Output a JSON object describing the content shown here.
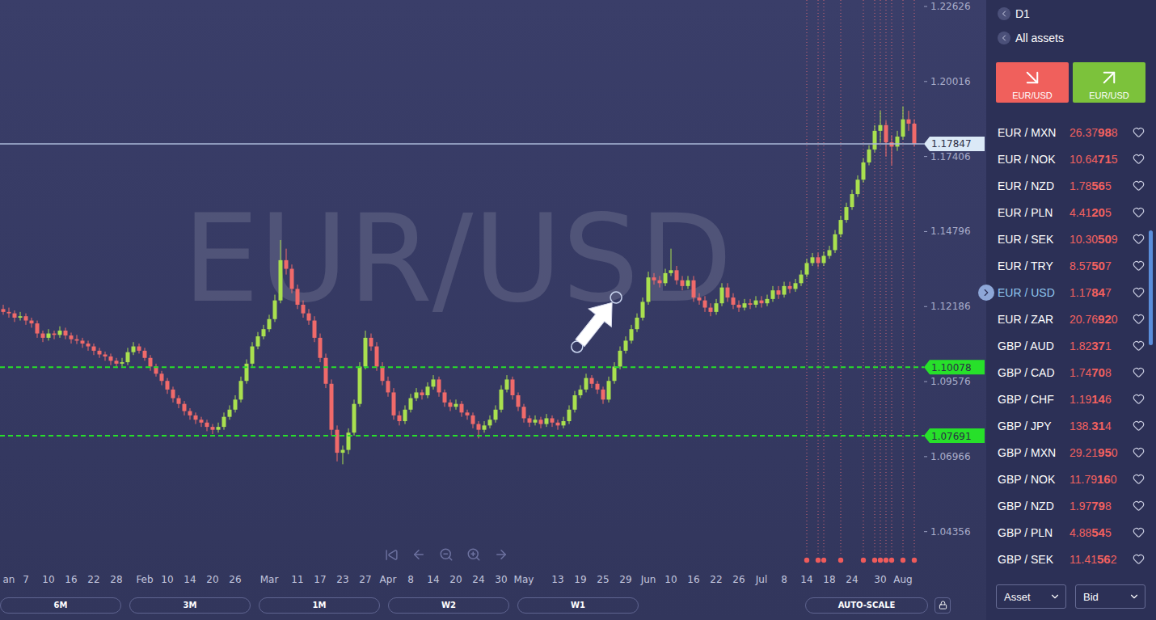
{
  "chart": {
    "watermark": "EUR/USD",
    "price_ticks": [
      "1.22626",
      "1.20016",
      "1.17406",
      "1.14796",
      "1.12186",
      "1.09576",
      "1.06966",
      "1.04356"
    ],
    "current_price": "1.17847",
    "levels": [
      "1.10078",
      "1.07691"
    ],
    "date_labels": [
      {
        "label": "an",
        "candle": 1
      },
      {
        "label": "7",
        "candle": 4
      },
      {
        "label": "10",
        "candle": 8
      },
      {
        "label": "16",
        "candle": 12
      },
      {
        "label": "22",
        "candle": 16
      },
      {
        "label": "28",
        "candle": 20
      },
      {
        "label": "Feb",
        "candle": 25
      },
      {
        "label": "10",
        "candle": 29
      },
      {
        "label": "14",
        "candle": 33
      },
      {
        "label": "20",
        "candle": 37
      },
      {
        "label": "26",
        "candle": 41
      },
      {
        "label": "Mar",
        "candle": 47
      },
      {
        "label": "11",
        "candle": 52
      },
      {
        "label": "17",
        "candle": 56
      },
      {
        "label": "23",
        "candle": 60
      },
      {
        "label": "27",
        "candle": 64
      },
      {
        "label": "Apr",
        "candle": 68
      },
      {
        "label": "8",
        "candle": 72
      },
      {
        "label": "14",
        "candle": 76
      },
      {
        "label": "20",
        "candle": 80
      },
      {
        "label": "24",
        "candle": 84
      },
      {
        "label": "30",
        "candle": 88
      },
      {
        "label": "May",
        "candle": 92
      },
      {
        "label": "13",
        "candle": 98
      },
      {
        "label": "19",
        "candle": 102
      },
      {
        "label": "25",
        "candle": 106
      },
      {
        "label": "29",
        "candle": 110
      },
      {
        "label": "Jun",
        "candle": 114
      },
      {
        "label": "10",
        "candle": 118
      },
      {
        "label": "16",
        "candle": 122
      },
      {
        "label": "22",
        "candle": 126
      },
      {
        "label": "26",
        "candle": 130
      },
      {
        "label": "Jul",
        "candle": 134
      },
      {
        "label": "8",
        "candle": 138
      },
      {
        "label": "14",
        "candle": 142
      },
      {
        "label": "18",
        "candle": 146
      },
      {
        "label": "24",
        "candle": 150
      },
      {
        "label": "30",
        "candle": 155
      },
      {
        "label": "Aug",
        "candle": 159
      }
    ],
    "trade_markers": [
      142,
      144,
      145,
      148,
      152,
      154,
      155,
      156,
      157,
      159,
      161
    ],
    "annotation": {
      "from": {
        "candle": 101.4,
        "price": 1.1079
      },
      "to": {
        "candle": 108.3,
        "price": 1.125
      }
    },
    "candles": [
      [
        1.121,
        1.1225,
        1.119,
        1.12
      ],
      [
        1.12,
        1.1215,
        1.118,
        1.1195
      ],
      [
        1.1195,
        1.1205,
        1.1165,
        1.118
      ],
      [
        1.118,
        1.12,
        1.117,
        1.1185
      ],
      [
        1.1185,
        1.1195,
        1.1155,
        1.117
      ],
      [
        1.117,
        1.118,
        1.1145,
        1.116
      ],
      [
        1.116,
        1.117,
        1.111,
        1.1125
      ],
      [
        1.1125,
        1.1135,
        1.1095,
        1.111
      ],
      [
        1.111,
        1.114,
        1.11,
        1.1125
      ],
      [
        1.1125,
        1.1135,
        1.1105,
        1.112
      ],
      [
        1.112,
        1.115,
        1.111,
        1.1135
      ],
      [
        1.1135,
        1.1145,
        1.1105,
        1.1118
      ],
      [
        1.1118,
        1.1128,
        1.109,
        1.1105
      ],
      [
        1.1105,
        1.112,
        1.1088,
        1.11
      ],
      [
        1.11,
        1.111,
        1.1075,
        1.109
      ],
      [
        1.109,
        1.11,
        1.1065,
        1.108
      ],
      [
        1.108,
        1.109,
        1.105,
        1.1065
      ],
      [
        1.1065,
        1.1075,
        1.104,
        1.1052
      ],
      [
        1.1052,
        1.1062,
        1.103,
        1.1045
      ],
      [
        1.1045,
        1.1055,
        1.1015,
        1.103
      ],
      [
        1.103,
        1.104,
        1.1005,
        1.102
      ],
      [
        1.102,
        1.104,
        1.101,
        1.1025
      ],
      [
        1.1025,
        1.1075,
        1.1015,
        1.106
      ],
      [
        1.106,
        1.1095,
        1.105,
        1.108
      ],
      [
        1.108,
        1.109,
        1.1055,
        1.1065
      ],
      [
        1.1065,
        1.1075,
        1.103,
        1.104
      ],
      [
        1.104,
        1.105,
        1.0995,
        1.101
      ],
      [
        1.101,
        1.102,
        1.0975,
        1.0985
      ],
      [
        1.0985,
        1.0995,
        1.0945,
        1.096
      ],
      [
        1.096,
        1.097,
        1.0915,
        1.093
      ],
      [
        1.093,
        1.094,
        1.0885,
        1.09
      ],
      [
        1.09,
        1.091,
        1.0865,
        1.088
      ],
      [
        1.088,
        1.089,
        1.084,
        1.0855
      ],
      [
        1.0855,
        1.0865,
        1.0825,
        1.084
      ],
      [
        1.084,
        1.085,
        1.081,
        1.0825
      ],
      [
        1.0825,
        1.0835,
        1.08,
        1.0815
      ],
      [
        1.0815,
        1.0825,
        1.0785,
        1.08
      ],
      [
        1.08,
        1.081,
        1.0775,
        1.079
      ],
      [
        1.079,
        1.0815,
        1.078,
        1.08
      ],
      [
        1.08,
        1.085,
        1.079,
        1.0835
      ],
      [
        1.0835,
        1.0875,
        1.0825,
        1.086
      ],
      [
        1.086,
        1.091,
        1.085,
        1.0895
      ],
      [
        1.0895,
        1.0975,
        1.0885,
        1.096
      ],
      [
        1.096,
        1.1035,
        1.095,
        1.102
      ],
      [
        1.102,
        1.1095,
        1.101,
        1.108
      ],
      [
        1.108,
        1.113,
        1.107,
        1.1115
      ],
      [
        1.1115,
        1.1155,
        1.1105,
        1.114
      ],
      [
        1.114,
        1.119,
        1.113,
        1.1175
      ],
      [
        1.1175,
        1.126,
        1.1165,
        1.124
      ],
      [
        1.124,
        1.145,
        1.123,
        1.138
      ],
      [
        1.138,
        1.142,
        1.133,
        1.135
      ],
      [
        1.135,
        1.1365,
        1.1265,
        1.128
      ],
      [
        1.128,
        1.1295,
        1.121,
        1.1225
      ],
      [
        1.1225,
        1.124,
        1.118,
        1.1195
      ],
      [
        1.1195,
        1.121,
        1.1155,
        1.117
      ],
      [
        1.117,
        1.1185,
        1.1095,
        1.111
      ],
      [
        1.111,
        1.1125,
        1.1025,
        1.104
      ],
      [
        1.104,
        1.1055,
        1.0935,
        1.095
      ],
      [
        1.095,
        1.0965,
        1.077,
        1.079
      ],
      [
        1.079,
        1.0805,
        1.068,
        1.071
      ],
      [
        1.071,
        1.0735,
        1.067,
        1.072
      ],
      [
        1.072,
        1.0795,
        1.0705,
        1.078
      ],
      [
        1.078,
        1.0895,
        1.077,
        1.088
      ],
      [
        1.088,
        1.1025,
        1.087,
        1.101
      ],
      [
        1.101,
        1.1135,
        1.1,
        1.111
      ],
      [
        1.111,
        1.1125,
        1.1065,
        1.108
      ],
      [
        1.108,
        1.1095,
        1.0995,
        1.101
      ],
      [
        1.101,
        1.1025,
        1.0945,
        1.096
      ],
      [
        1.096,
        1.0975,
        1.0905,
        1.092
      ],
      [
        1.092,
        1.0935,
        1.0825,
        1.084
      ],
      [
        1.084,
        1.0855,
        1.0805,
        1.082
      ],
      [
        1.082,
        1.0875,
        1.081,
        1.086
      ],
      [
        1.086,
        1.0915,
        1.085,
        1.09
      ],
      [
        1.09,
        1.0935,
        1.089,
        1.092
      ],
      [
        1.092,
        1.093,
        1.0895,
        1.091
      ],
      [
        1.091,
        1.0955,
        1.09,
        1.094
      ],
      [
        1.094,
        1.098,
        1.093,
        1.0965
      ],
      [
        1.0965,
        1.0975,
        1.0905,
        1.092
      ],
      [
        1.092,
        1.093,
        1.087,
        1.0885
      ],
      [
        1.0885,
        1.0895,
        1.0855,
        1.087
      ],
      [
        1.087,
        1.0895,
        1.086,
        1.088
      ],
      [
        1.088,
        1.089,
        1.0835,
        1.085
      ],
      [
        1.085,
        1.086,
        1.0825,
        1.084
      ],
      [
        1.084,
        1.085,
        1.0795,
        1.081
      ],
      [
        1.081,
        1.082,
        1.076,
        1.079
      ],
      [
        1.079,
        1.082,
        1.078,
        1.0805
      ],
      [
        1.0805,
        1.084,
        1.0795,
        1.0825
      ],
      [
        1.0825,
        1.0875,
        1.0815,
        1.086
      ],
      [
        1.086,
        1.0945,
        1.085,
        1.093
      ],
      [
        1.093,
        1.098,
        1.092,
        1.0965
      ],
      [
        1.0965,
        1.0975,
        1.0895,
        1.091
      ],
      [
        1.091,
        1.092,
        1.0855,
        1.087
      ],
      [
        1.087,
        1.088,
        1.0815,
        1.083
      ],
      [
        1.083,
        1.084,
        1.08,
        1.0815
      ],
      [
        1.0815,
        1.084,
        1.0805,
        1.0825
      ],
      [
        1.0825,
        1.0835,
        1.0795,
        1.081
      ],
      [
        1.081,
        1.0845,
        1.08,
        1.083
      ],
      [
        1.083,
        1.084,
        1.08,
        1.0815
      ],
      [
        1.0815,
        1.0825,
        1.079,
        1.0805
      ],
      [
        1.0805,
        1.0835,
        1.0795,
        1.082
      ],
      [
        1.082,
        1.0875,
        1.081,
        1.086
      ],
      [
        1.086,
        1.0925,
        1.085,
        1.091
      ],
      [
        1.091,
        1.0945,
        1.09,
        1.093
      ],
      [
        1.093,
        1.0985,
        1.092,
        1.097
      ],
      [
        1.097,
        1.098,
        1.0935,
        1.095
      ],
      [
        1.095,
        1.096,
        1.0915,
        1.093
      ],
      [
        1.093,
        1.094,
        1.088,
        1.0895
      ],
      [
        1.0895,
        1.0975,
        1.0885,
        1.096
      ],
      [
        1.096,
        1.1025,
        1.095,
        1.101
      ],
      [
        1.101,
        1.108,
        1.1,
        1.1065
      ],
      [
        1.1065,
        1.1115,
        1.1055,
        1.11
      ],
      [
        1.11,
        1.1155,
        1.109,
        1.114
      ],
      [
        1.114,
        1.1195,
        1.113,
        1.118
      ],
      [
        1.118,
        1.125,
        1.117,
        1.1235
      ],
      [
        1.1235,
        1.134,
        1.1225,
        1.132
      ],
      [
        1.132,
        1.1335,
        1.1295,
        1.131
      ],
      [
        1.131,
        1.1325,
        1.1285,
        1.13
      ],
      [
        1.13,
        1.135,
        1.129,
        1.1335
      ],
      [
        1.1335,
        1.142,
        1.1325,
        1.1345
      ],
      [
        1.1345,
        1.136,
        1.1295,
        1.131
      ],
      [
        1.131,
        1.1325,
        1.1275,
        1.129
      ],
      [
        1.129,
        1.1325,
        1.128,
        1.131
      ],
      [
        1.131,
        1.1325,
        1.1235,
        1.125
      ],
      [
        1.125,
        1.1265,
        1.1225,
        1.124
      ],
      [
        1.124,
        1.1255,
        1.12,
        1.1215
      ],
      [
        1.1215,
        1.123,
        1.1185,
        1.12
      ],
      [
        1.12,
        1.1245,
        1.119,
        1.123
      ],
      [
        1.123,
        1.13,
        1.122,
        1.1285
      ],
      [
        1.1285,
        1.13,
        1.1235,
        1.125
      ],
      [
        1.125,
        1.1265,
        1.121,
        1.1225
      ],
      [
        1.1225,
        1.124,
        1.12,
        1.1215
      ],
      [
        1.1215,
        1.1245,
        1.1205,
        1.123
      ],
      [
        1.123,
        1.1245,
        1.121,
        1.1225
      ],
      [
        1.1225,
        1.1255,
        1.1215,
        1.124
      ],
      [
        1.124,
        1.1255,
        1.1215,
        1.123
      ],
      [
        1.123,
        1.126,
        1.122,
        1.1245
      ],
      [
        1.1245,
        1.129,
        1.1235,
        1.1275
      ],
      [
        1.1275,
        1.129,
        1.1245,
        1.126
      ],
      [
        1.126,
        1.1305,
        1.125,
        1.129
      ],
      [
        1.129,
        1.1305,
        1.1265,
        1.128
      ],
      [
        1.128,
        1.1315,
        1.127,
        1.13
      ],
      [
        1.13,
        1.1345,
        1.129,
        1.133
      ],
      [
        1.133,
        1.1385,
        1.132,
        1.137
      ],
      [
        1.137,
        1.1405,
        1.136,
        1.139
      ],
      [
        1.139,
        1.1405,
        1.1355,
        1.137
      ],
      [
        1.137,
        1.141,
        1.136,
        1.1395
      ],
      [
        1.1395,
        1.143,
        1.1385,
        1.1415
      ],
      [
        1.1415,
        1.1485,
        1.1405,
        1.147
      ],
      [
        1.147,
        1.1535,
        1.146,
        1.152
      ],
      [
        1.152,
        1.158,
        1.151,
        1.1565
      ],
      [
        1.1565,
        1.1625,
        1.1555,
        1.161
      ],
      [
        1.161,
        1.1675,
        1.16,
        1.166
      ],
      [
        1.166,
        1.1735,
        1.165,
        1.172
      ],
      [
        1.172,
        1.178,
        1.171,
        1.1765
      ],
      [
        1.1765,
        1.185,
        1.1755,
        1.183
      ],
      [
        1.183,
        1.19,
        1.179,
        1.185
      ],
      [
        1.185,
        1.1865,
        1.174,
        1.179
      ],
      [
        1.179,
        1.1815,
        1.171,
        1.1775
      ],
      [
        1.1775,
        1.183,
        1.176,
        1.181
      ],
      [
        1.181,
        1.1915,
        1.18,
        1.187
      ],
      [
        1.187,
        1.19,
        1.183,
        1.1855
      ],
      [
        1.1855,
        1.187,
        1.1775,
        1.1785
      ]
    ]
  },
  "toolbar": {
    "periods": [
      {
        "label": "6M",
        "selected": false
      },
      {
        "label": "3M",
        "selected": false
      },
      {
        "label": "1M",
        "selected": false
      },
      {
        "label": "W2",
        "selected": false
      },
      {
        "label": "W1",
        "selected": false
      }
    ],
    "autoscale": "AUTO-SCALE",
    "locked": false
  },
  "panel": {
    "timeframe": "D1",
    "category": "All assets",
    "sell": {
      "label": "EUR/USD"
    },
    "buy": {
      "label": "EUR/USD"
    },
    "assets": [
      {
        "pair": "EUR / MXN",
        "price": [
          "26.37",
          "98",
          "8"
        ],
        "selected": false,
        "favorite": false
      },
      {
        "pair": "EUR / NOK",
        "price": [
          "10.64",
          "71",
          "5"
        ],
        "selected": false,
        "favorite": false
      },
      {
        "pair": "EUR / NZD",
        "price": [
          "1.78",
          "56",
          "5"
        ],
        "selected": false,
        "favorite": false
      },
      {
        "pair": "EUR / PLN",
        "price": [
          "4.41",
          "20",
          "5"
        ],
        "selected": false,
        "favorite": false
      },
      {
        "pair": "EUR / SEK",
        "price": [
          "10.30",
          "50",
          "9"
        ],
        "selected": false,
        "favorite": false
      },
      {
        "pair": "EUR / TRY",
        "price": [
          "8.57",
          "50",
          "7"
        ],
        "selected": false,
        "favorite": false
      },
      {
        "pair": "EUR / USD",
        "price": [
          "1.17",
          "84",
          "7"
        ],
        "selected": true,
        "favorite": false
      },
      {
        "pair": "EUR / ZAR",
        "price": [
          "20.76",
          "92",
          "0"
        ],
        "selected": false,
        "favorite": false
      },
      {
        "pair": "GBP / AUD",
        "price": [
          "1.82",
          "37",
          "1"
        ],
        "selected": false,
        "favorite": false
      },
      {
        "pair": "GBP / CAD",
        "price": [
          "1.74",
          "70",
          "8"
        ],
        "selected": false,
        "favorite": false
      },
      {
        "pair": "GBP / CHF",
        "price": [
          "1.19",
          "14",
          "6"
        ],
        "selected": false,
        "favorite": false
      },
      {
        "pair": "GBP / JPY",
        "price": [
          "138.",
          "31",
          "4"
        ],
        "selected": false,
        "favorite": false
      },
      {
        "pair": "GBP / MXN",
        "price": [
          "29.21",
          "95",
          "0"
        ],
        "selected": false,
        "favorite": false
      },
      {
        "pair": "GBP / NOK",
        "price": [
          "11.79",
          "16",
          "0"
        ],
        "selected": false,
        "favorite": false
      },
      {
        "pair": "GBP / NZD",
        "price": [
          "1.97",
          "79",
          "8"
        ],
        "selected": false,
        "favorite": false
      },
      {
        "pair": "GBP / PLN",
        "price": [
          "4.88",
          "54",
          "5"
        ],
        "selected": false,
        "favorite": false
      },
      {
        "pair": "GBP / SEK",
        "price": [
          "11.41",
          "56",
          "2"
        ],
        "selected": false,
        "favorite": false
      }
    ],
    "list_scroll": {
      "offset": 0.245,
      "visible": 0.254
    },
    "sort": "Asset",
    "price_type": "Bid"
  }
}
